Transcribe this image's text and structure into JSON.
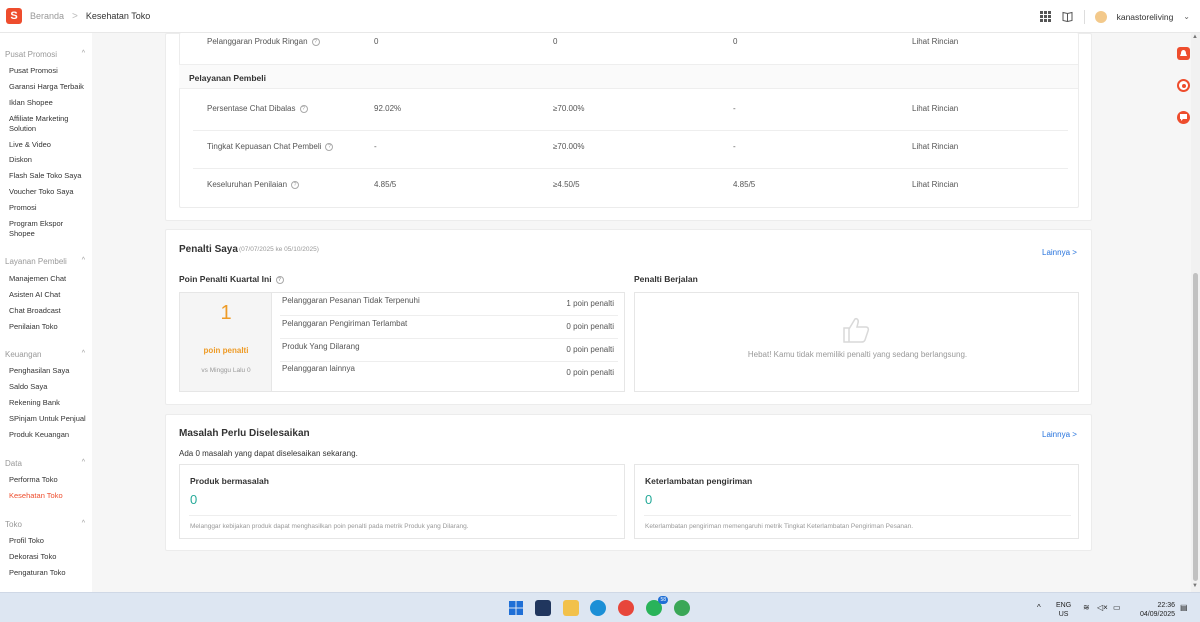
{
  "header": {
    "logo": "S",
    "breadcrumb_home": "Beranda",
    "breadcrumb_sep": ">",
    "breadcrumb_current": "Kesehatan Toko",
    "username": "kanastoreliving",
    "caret": "⌄"
  },
  "sidebar": {
    "groups": [
      {
        "title": "Pusat Promosi",
        "items": [
          "Pusat Promosi",
          "Garansi Harga Terbaik",
          "Iklan Shopee",
          "Affiliate Marketing Solution",
          "Live & Video",
          "Diskon",
          "Flash Sale Toko Saya",
          "Voucher Toko Saya",
          "Promosi",
          "Program Ekspor Shopee"
        ]
      },
      {
        "title": "Layanan Pembeli",
        "items": [
          "Manajemen Chat",
          "Asisten AI Chat",
          "Chat Broadcast",
          "Penilaian Toko"
        ]
      },
      {
        "title": "Keuangan",
        "items": [
          "Penghasilan Saya",
          "Saldo Saya",
          "Rekening Bank",
          "SPinjam Untuk Penjual",
          "Produk Keuangan"
        ]
      },
      {
        "title": "Data",
        "items": [
          "Performa Toko",
          "Kesehatan Toko"
        ]
      },
      {
        "title": "Toko",
        "items": [
          "Profil Toko",
          "Dekorasi Toko",
          "Pengaturan Toko"
        ]
      }
    ],
    "active_item": "Kesehatan Toko"
  },
  "metrics": {
    "top_row": {
      "name": "Pelanggaran Produk Ringan",
      "current": "0",
      "target": "0",
      "previous": "0",
      "link": "Lihat Rincian"
    },
    "section_title": "Pelayanan Pembeli",
    "rows": [
      {
        "name": "Persentase Chat Dibalas",
        "current": "92.02%",
        "target": "≥70.00%",
        "previous": "-",
        "link": "Lihat Rincian"
      },
      {
        "name": "Tingkat Kepuasan Chat Pembeli",
        "current": "-",
        "target": "≥70.00%",
        "previous": "-",
        "link": "Lihat Rincian"
      },
      {
        "name": "Keseluruhan Penilaian",
        "current": "4.85/5",
        "target": "≥4.50/5",
        "previous": "4.85/5",
        "link": "Lihat Rincian"
      }
    ]
  },
  "penalty": {
    "title": "Penalti Saya",
    "period": "(07/07/2025 ke 05/10/2025)",
    "more": "Lainnya >",
    "quarter_title": "Poin Penalti Kuartal Ini",
    "points": "1",
    "points_label": "poin penalti",
    "vs_last_week": "vs Minggu Lalu 0",
    "items": [
      {
        "label": "Pelanggaran Pesanan Tidak Terpenuhi",
        "value": "1 poin penalti"
      },
      {
        "label": "Pelanggaran Pengiriman Terlambat",
        "value": "0 poin penalti"
      },
      {
        "label": "Produk Yang Dilarang",
        "value": "0 poin penalti"
      },
      {
        "label": "Pelanggaran lainnya",
        "value": "0 poin penalti"
      }
    ],
    "ongoing_title": "Penalti Berjalan",
    "ongoing_empty": "Hebat! Kamu tidak memiliki penalti yang sedang berlangsung."
  },
  "issues": {
    "title": "Masalah Perlu Diselesaikan",
    "more": "Lainnya >",
    "summary": "Ada 0 masalah yang dapat diselesaikan sekarang.",
    "cards": [
      {
        "title": "Produk bermasalah",
        "count": "0",
        "desc": "Melanggar kebijakan produk dapat menghasilkan poin penalti pada metrik Produk yang Dilarang."
      },
      {
        "title": "Keterlambatan pengiriman",
        "count": "0",
        "desc": "Keterlambatan pengiriman memengaruhi metrik Tingkat Keterlambatan Pengiriman Pesanan."
      }
    ]
  },
  "taskbar": {
    "lang": "ENG",
    "region": "US",
    "time": "22:36",
    "date": "04/09/2025",
    "badge_whatsapp": "58"
  },
  "colors": {
    "brand": "#ee4d2d",
    "link": "#2673dd",
    "penalty": "#ee9b26",
    "success": "#26aa99"
  }
}
